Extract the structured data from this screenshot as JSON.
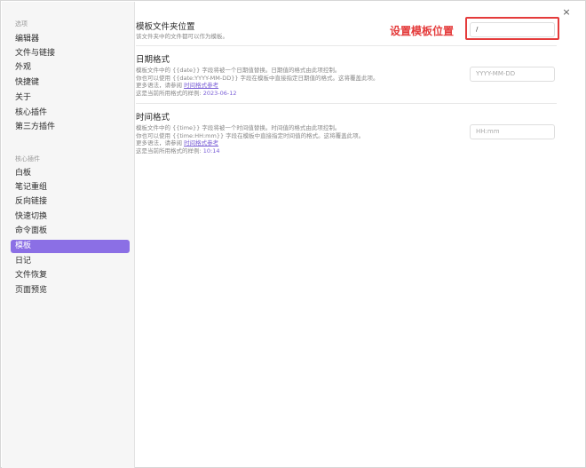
{
  "sidebar": {
    "options_title": "选项",
    "options_items": [
      "编辑器",
      "文件与链接",
      "外观",
      "快捷键",
      "关于",
      "核心插件",
      "第三方插件"
    ],
    "plugins_title": "核心插件",
    "plugin_items": [
      "白板",
      "笔记重组",
      "反向链接",
      "快速切换",
      "命令面板",
      "模板",
      "日记",
      "文件恢复",
      "页面预览"
    ],
    "active_item": "模板"
  },
  "settings": {
    "folder": {
      "name": "模板文件夹位置",
      "desc": "该文件夹中的文件都可以作为模板。",
      "value": "/"
    },
    "date": {
      "name": "日期格式",
      "desc_line1": "模板文件中的 {{date}} 字段将被一个日期值替换。日期值的格式由此项控制。",
      "desc_line2": "你也可以使用 {{date:YYYY-MM-DD}} 字段在模板中直接指定日期值的格式。这将覆盖此项。",
      "more_prefix": "更多语法，请参阅 ",
      "more_link": "时间格式参考",
      "sample_prefix": "这是当前所用格式的样例: ",
      "sample": "2023-06-12",
      "placeholder": "YYYY-MM-DD"
    },
    "time": {
      "name": "时间格式",
      "desc_line1": "模板文件中的 {{time}} 字段将被一个时间值替换。时间值的格式由此项控制。",
      "desc_line2": "你也可以使用 {{time:HH:mm}} 字段在模板中直接指定时间值的格式。这将覆盖此项。",
      "more_prefix": "更多语法，请参阅 ",
      "more_link": "时间格式参考",
      "sample_prefix": "这是当前所用格式的样例: ",
      "sample": "10:14",
      "placeholder": "HH:mm"
    }
  },
  "annotation": "设置模板位置",
  "close_glyph": "×",
  "colors": {
    "accent": "#8b6fe5",
    "annotation": "#e43b3b"
  }
}
